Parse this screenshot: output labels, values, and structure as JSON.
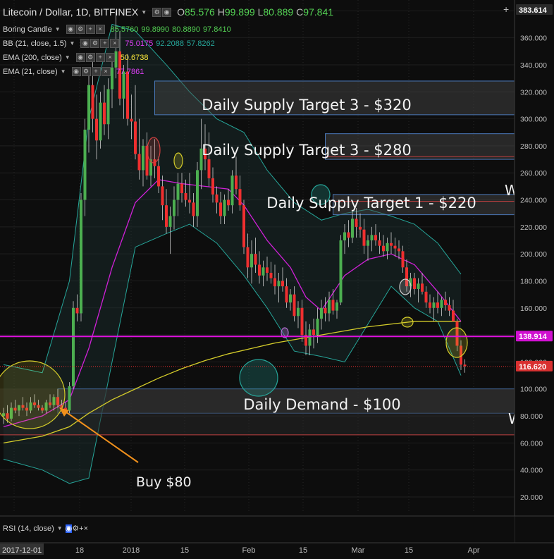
{
  "header": {
    "symbol": "Litecoin / Dollar, 1D, BITFINEX",
    "ohlc": {
      "o_label": "O",
      "o": "85.576",
      "h_label": "H",
      "h": "99.899",
      "l_label": "L",
      "l": "80.889",
      "c_label": "C",
      "c": "97.841"
    },
    "indicators": [
      {
        "name": "Boring Candle",
        "values": [
          "85.5760",
          "99.8990",
          "80.8890",
          "97.8410"
        ],
        "color": "#54d154"
      },
      {
        "name": "BB (21, close, 1.5)",
        "values": [
          "75.0175",
          "92.2088",
          "57.8262"
        ],
        "colors": [
          "#e040fb",
          "#26a69a",
          "#26a69a"
        ]
      },
      {
        "name": "EMA (200, close)",
        "values": [
          "50.6738"
        ],
        "color": "#ffeb3b"
      },
      {
        "name": "EMA (21, close)",
        "values": [
          "77.7861"
        ],
        "color": "#e040fb"
      }
    ],
    "rsi_label": "RSI (14, close)"
  },
  "colors": {
    "up": "#4caf50",
    "down": "#ef2f2f",
    "bb": "#26a69a",
    "ema200": "#d4cc2a",
    "ema21": "#d020d8",
    "magenta_line": "#e010e0",
    "zone_border": "#4a78b8"
  },
  "chart_data": {
    "type": "candlestick",
    "x_tick_labels": [
      "2017-12-01",
      "18",
      "2018",
      "15",
      "Feb",
      "15",
      "Mar",
      "15",
      "Apr"
    ],
    "y_ticks": [
      "20.000",
      "40.000",
      "60.000",
      "80.000",
      "100.000",
      "120.000",
      "140.000",
      "160.000",
      "180.000",
      "200.000",
      "220.000",
      "240.000",
      "260.000",
      "280.000",
      "300.000",
      "320.000",
      "340.000",
      "360.000",
      "380.000"
    ],
    "ylim": [
      8,
      388
    ],
    "price_labels": {
      "top": "383.614",
      "magenta": "138.914",
      "last": "116.620"
    },
    "magenta_level": 138.914,
    "last_price": 116.62,
    "zones": [
      {
        "label": "Daily Supply Target 3 - $320",
        "low": 303,
        "high": 328,
        "start_day": 39
      },
      {
        "label": "Daily Supply Target 3 - $280",
        "low": 270,
        "high": 289,
        "start_day": 83
      },
      {
        "label": "Daily Supply Target 1 - $220",
        "low": 229,
        "high": 244,
        "start_day": 85
      },
      {
        "label": "Daily Demand - $100",
        "low": 82,
        "high": 100,
        "start_day": 14
      }
    ],
    "annotation": {
      "label": "Buy $80",
      "price": 80
    },
    "partial_letters": [
      "W",
      "W"
    ],
    "candles": [
      [
        0,
        80,
        86,
        74,
        82
      ],
      [
        1,
        82,
        88,
        75,
        78
      ],
      [
        2,
        78,
        90,
        76,
        86
      ],
      [
        3,
        86,
        92,
        82,
        84
      ],
      [
        4,
        84,
        88,
        80,
        88
      ],
      [
        5,
        88,
        94,
        84,
        86
      ],
      [
        6,
        86,
        90,
        80,
        84
      ],
      [
        7,
        84,
        94,
        82,
        90
      ],
      [
        8,
        90,
        96,
        86,
        88
      ],
      [
        9,
        88,
        92,
        84,
        86
      ],
      [
        10,
        86,
        88,
        82,
        84
      ],
      [
        11,
        84,
        92,
        82,
        90
      ],
      [
        12,
        90,
        96,
        86,
        88
      ],
      [
        13,
        88,
        96,
        84,
        94
      ],
      [
        14,
        94,
        100,
        86,
        88
      ],
      [
        15,
        88,
        92,
        84,
        86
      ],
      [
        16,
        86,
        90,
        82,
        84
      ],
      [
        17,
        84,
        105,
        82,
        102
      ],
      [
        18,
        102,
        165,
        100,
        160
      ],
      [
        19,
        160,
        170,
        150,
        156
      ],
      [
        20,
        156,
        245,
        150,
        240
      ],
      [
        21,
        240,
        300,
        228,
        292
      ],
      [
        22,
        292,
        335,
        275,
        325
      ],
      [
        23,
        325,
        342,
        290,
        300
      ],
      [
        24,
        300,
        318,
        270,
        284
      ],
      [
        25,
        284,
        320,
        278,
        312
      ],
      [
        26,
        312,
        325,
        288,
        296
      ],
      [
        27,
        296,
        330,
        285,
        322
      ],
      [
        28,
        322,
        345,
        308,
        338
      ],
      [
        29,
        338,
        380,
        330,
        350
      ],
      [
        30,
        350,
        365,
        310,
        315
      ],
      [
        31,
        315,
        340,
        300,
        335
      ],
      [
        32,
        335,
        348,
        295,
        300
      ],
      [
        33,
        300,
        318,
        285,
        298
      ],
      [
        34,
        298,
        325,
        270,
        274
      ],
      [
        35,
        274,
        300,
        255,
        262
      ],
      [
        36,
        262,
        285,
        250,
        280
      ],
      [
        37,
        280,
        290,
        255,
        258
      ],
      [
        38,
        258,
        280,
        250,
        270
      ],
      [
        39,
        270,
        285,
        256,
        265
      ],
      [
        40,
        265,
        272,
        245,
        250
      ],
      [
        41,
        250,
        258,
        225,
        236
      ],
      [
        42,
        236,
        248,
        215,
        220
      ],
      [
        43,
        220,
        235,
        200,
        228
      ],
      [
        44,
        228,
        250,
        218,
        240
      ],
      [
        45,
        240,
        260,
        228,
        252
      ],
      [
        46,
        252,
        260,
        238,
        245
      ],
      [
        47,
        245,
        255,
        235,
        240
      ],
      [
        48,
        240,
        260,
        230,
        238
      ],
      [
        49,
        238,
        245,
        220,
        228
      ],
      [
        50,
        228,
        268,
        220,
        262
      ],
      [
        51,
        262,
        300,
        248,
        278
      ],
      [
        52,
        278,
        296,
        262,
        270
      ],
      [
        53,
        270,
        290,
        250,
        256
      ],
      [
        54,
        256,
        264,
        238,
        244
      ],
      [
        55,
        244,
        250,
        230,
        238
      ],
      [
        56,
        238,
        246,
        222,
        228
      ],
      [
        57,
        228,
        244,
        222,
        240
      ],
      [
        58,
        240,
        248,
        232,
        236
      ],
      [
        59,
        236,
        262,
        230,
        258
      ],
      [
        60,
        258,
        272,
        244,
        248
      ],
      [
        61,
        248,
        258,
        232,
        236
      ],
      [
        62,
        236,
        240,
        200,
        205
      ],
      [
        63,
        205,
        215,
        182,
        190
      ],
      [
        64,
        190,
        210,
        178,
        200
      ],
      [
        65,
        200,
        212,
        186,
        192
      ],
      [
        66,
        192,
        202,
        178,
        184
      ],
      [
        67,
        184,
        195,
        176,
        190
      ],
      [
        68,
        190,
        198,
        180,
        186
      ],
      [
        69,
        186,
        194,
        178,
        182
      ],
      [
        70,
        182,
        192,
        170,
        176
      ],
      [
        71,
        176,
        186,
        164,
        180
      ],
      [
        72,
        180,
        190,
        172,
        176
      ],
      [
        73,
        176,
        182,
        160,
        164
      ],
      [
        74,
        164,
        174,
        158,
        170
      ],
      [
        75,
        170,
        176,
        150,
        154
      ],
      [
        76,
        154,
        165,
        145,
        160
      ],
      [
        77,
        160,
        166,
        135,
        140
      ],
      [
        78,
        140,
        150,
        125,
        132
      ],
      [
        79,
        132,
        148,
        125,
        144
      ],
      [
        80,
        144,
        152,
        130,
        140
      ],
      [
        81,
        140,
        160,
        134,
        152
      ],
      [
        82,
        152,
        166,
        144,
        160
      ],
      [
        83,
        160,
        168,
        150,
        156
      ],
      [
        84,
        156,
        172,
        150,
        166
      ],
      [
        85,
        166,
        174,
        155,
        158
      ],
      [
        86,
        158,
        166,
        152,
        164
      ],
      [
        87,
        164,
        214,
        162,
        210
      ],
      [
        88,
        210,
        222,
        200,
        216
      ],
      [
        89,
        216,
        225,
        205,
        212
      ],
      [
        90,
        212,
        232,
        208,
        226
      ],
      [
        91,
        226,
        234,
        212,
        220
      ],
      [
        92,
        220,
        230,
        212,
        218
      ],
      [
        93,
        218,
        226,
        200,
        206
      ],
      [
        94,
        206,
        214,
        195,
        210
      ],
      [
        95,
        210,
        220,
        202,
        214
      ],
      [
        96,
        214,
        222,
        206,
        210
      ],
      [
        97,
        210,
        216,
        200,
        206
      ],
      [
        98,
        206,
        214,
        198,
        202
      ],
      [
        99,
        202,
        212,
        196,
        208
      ],
      [
        100,
        208,
        216,
        200,
        206
      ],
      [
        101,
        206,
        212,
        198,
        204
      ],
      [
        102,
        204,
        210,
        196,
        202
      ],
      [
        103,
        202,
        206,
        186,
        190
      ],
      [
        104,
        190,
        196,
        172,
        176
      ],
      [
        105,
        176,
        186,
        168,
        182
      ],
      [
        106,
        182,
        186,
        170,
        174
      ],
      [
        107,
        174,
        182,
        164,
        178
      ],
      [
        108,
        178,
        186,
        170,
        172
      ],
      [
        109,
        172,
        176,
        160,
        164
      ],
      [
        110,
        164,
        170,
        156,
        160
      ],
      [
        111,
        160,
        168,
        150,
        164
      ],
      [
        112,
        164,
        172,
        156,
        160
      ],
      [
        113,
        160,
        168,
        154,
        166
      ],
      [
        114,
        166,
        172,
        158,
        162
      ],
      [
        115,
        162,
        168,
        154,
        158
      ],
      [
        116,
        158,
        166,
        150,
        150
      ],
      [
        117,
        150,
        152,
        128,
        132
      ],
      [
        118,
        132,
        136,
        114,
        118
      ],
      [
        119,
        118,
        122,
        112,
        117
      ]
    ],
    "bb_upper": [
      [
        0,
        118
      ],
      [
        10,
        112
      ],
      [
        17,
        180
      ],
      [
        22,
        300
      ],
      [
        28,
        370
      ],
      [
        34,
        365
      ],
      [
        42,
        340
      ],
      [
        48,
        320
      ],
      [
        55,
        300
      ],
      [
        62,
        290
      ],
      [
        68,
        262
      ],
      [
        75,
        238
      ],
      [
        82,
        225
      ],
      [
        88,
        230
      ],
      [
        94,
        233
      ],
      [
        100,
        228
      ],
      [
        106,
        222
      ],
      [
        112,
        208
      ],
      [
        118,
        185
      ]
    ],
    "bb_lower": [
      [
        0,
        48
      ],
      [
        10,
        40
      ],
      [
        17,
        30
      ],
      [
        22,
        34
      ],
      [
        28,
        120
      ],
      [
        34,
        205
      ],
      [
        42,
        215
      ],
      [
        48,
        222
      ],
      [
        55,
        208
      ],
      [
        62,
        184
      ],
      [
        68,
        160
      ],
      [
        75,
        128
      ],
      [
        82,
        124
      ],
      [
        88,
        120
      ],
      [
        94,
        148
      ],
      [
        100,
        176
      ],
      [
        106,
        160
      ],
      [
        112,
        150
      ],
      [
        118,
        110
      ]
    ],
    "ema200": [
      [
        0,
        60
      ],
      [
        10,
        65
      ],
      [
        17,
        72
      ],
      [
        22,
        82
      ],
      [
        28,
        92
      ],
      [
        34,
        100
      ],
      [
        40,
        108
      ],
      [
        46,
        115
      ],
      [
        52,
        121
      ],
      [
        58,
        126
      ],
      [
        64,
        130
      ],
      [
        70,
        134
      ],
      [
        76,
        137
      ],
      [
        82,
        140
      ],
      [
        88,
        143
      ],
      [
        94,
        146
      ],
      [
        100,
        148
      ],
      [
        106,
        150
      ],
      [
        112,
        150
      ],
      [
        118,
        150
      ]
    ],
    "ema21": [
      [
        0,
        72
      ],
      [
        10,
        80
      ],
      [
        17,
        92
      ],
      [
        22,
        130
      ],
      [
        28,
        190
      ],
      [
        34,
        238
      ],
      [
        40,
        255
      ],
      [
        46,
        252
      ],
      [
        52,
        250
      ],
      [
        58,
        248
      ],
      [
        62,
        236
      ],
      [
        68,
        210
      ],
      [
        74,
        190
      ],
      [
        78,
        168
      ],
      [
        82,
        158
      ],
      [
        88,
        184
      ],
      [
        94,
        196
      ],
      [
        100,
        200
      ],
      [
        106,
        192
      ],
      [
        112,
        172
      ],
      [
        118,
        150
      ]
    ]
  }
}
